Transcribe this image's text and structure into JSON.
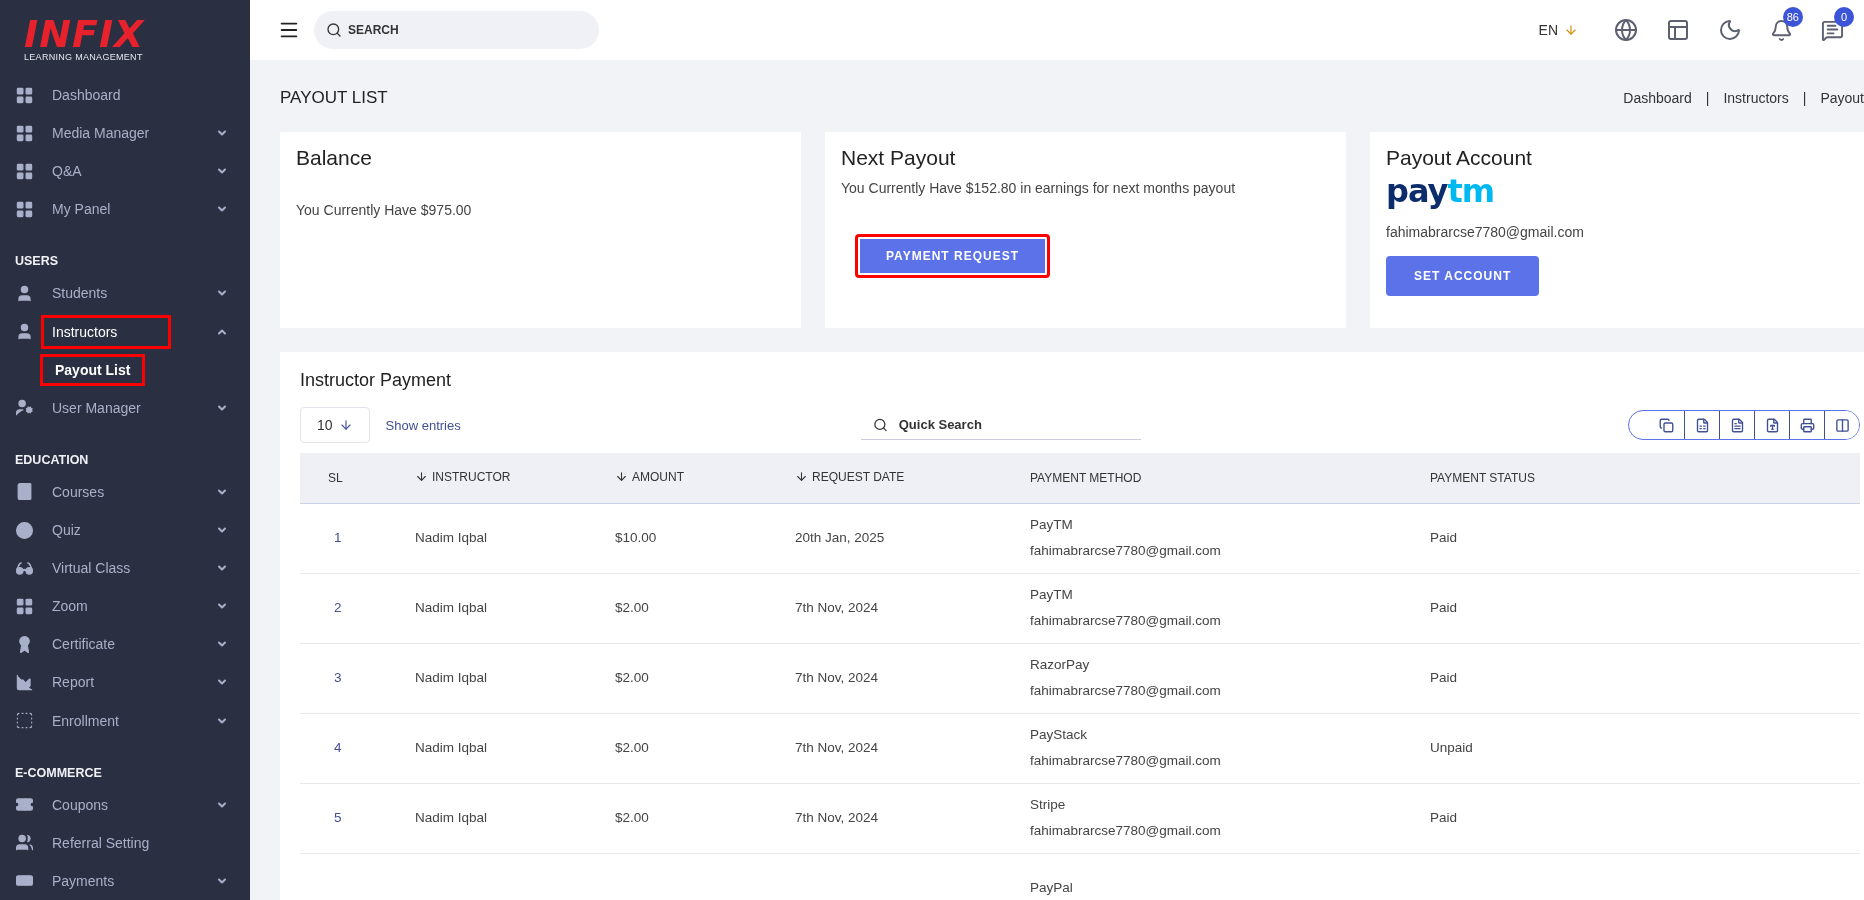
{
  "logo": {
    "brand": "INFIX",
    "tagline": "LEARNING MANAGEMENT"
  },
  "sidebar": {
    "sections": [
      {
        "items": [
          {
            "label": "Dashboard",
            "expandable": false,
            "expanded": false,
            "highlighted": false
          },
          {
            "label": "Media Manager",
            "expandable": true,
            "expanded": false,
            "highlighted": false
          },
          {
            "label": "Q&A",
            "expandable": true,
            "expanded": false,
            "highlighted": false
          },
          {
            "label": "My Panel",
            "expandable": true,
            "expanded": false,
            "highlighted": false
          }
        ]
      },
      {
        "heading": "USERS",
        "items": [
          {
            "label": "Students",
            "expandable": true,
            "expanded": false,
            "highlighted": false
          },
          {
            "label": "Instructors",
            "expandable": true,
            "expanded": true,
            "highlighted": true,
            "children": [
              {
                "label": "Payout List",
                "selected": true,
                "highlighted": true
              }
            ]
          },
          {
            "label": "User Manager",
            "expandable": true,
            "expanded": false,
            "highlighted": false
          }
        ]
      },
      {
        "heading": "EDUCATION",
        "items": [
          {
            "label": "Courses",
            "expandable": true,
            "expanded": false,
            "highlighted": false
          },
          {
            "label": "Quiz",
            "expandable": true,
            "expanded": false,
            "highlighted": false
          },
          {
            "label": "Virtual Class",
            "expandable": true,
            "expanded": false,
            "highlighted": false
          },
          {
            "label": "Zoom",
            "expandable": true,
            "expanded": false,
            "highlighted": false
          },
          {
            "label": "Certificate",
            "expandable": true,
            "expanded": false,
            "highlighted": false
          },
          {
            "label": "Report",
            "expandable": true,
            "expanded": false,
            "highlighted": false
          },
          {
            "label": "Enrollment",
            "expandable": true,
            "expanded": false,
            "highlighted": false
          }
        ]
      },
      {
        "heading": "E-COMMERCE",
        "items": [
          {
            "label": "Coupons",
            "expandable": true,
            "expanded": false,
            "highlighted": false
          },
          {
            "label": "Referral Setting",
            "expandable": false,
            "expanded": false,
            "highlighted": false
          },
          {
            "label": "Payments",
            "expandable": true,
            "expanded": false,
            "highlighted": false
          }
        ]
      }
    ]
  },
  "topbar": {
    "search": {
      "placeholder": "SEARCH"
    },
    "language": "EN",
    "notifications": "86",
    "messages": "0"
  },
  "page": {
    "title": "PAYOUT LIST",
    "breadcrumbs": [
      "Dashboard",
      "Instructors",
      "Payout"
    ],
    "separator": "|"
  },
  "cards": {
    "balance": {
      "title": "Balance",
      "text": "You Currently Have $975.00"
    },
    "next_payout": {
      "title": "Next Payout",
      "text": "You Currently Have $152.80 in earnings for next months payout",
      "button": "PAYMENT REQUEST",
      "highlighted": true
    },
    "payout_account": {
      "title": "Payout Account",
      "logo_parts": [
        "pay",
        "tm"
      ],
      "email": "fahimabrarcse7780@gmail.com",
      "button": "SET ACCOUNT"
    }
  },
  "table": {
    "title": "Instructor Payment",
    "page_size": "10",
    "show_entries": "Show entries",
    "search": {
      "placeholder": "Quick Search"
    },
    "columns": [
      {
        "label": "SL",
        "sortable": false
      },
      {
        "label": "INSTRUCTOR",
        "sortable": true
      },
      {
        "label": "AMOUNT",
        "sortable": true
      },
      {
        "label": "REQUEST DATE",
        "sortable": true
      },
      {
        "label": "PAYMENT METHOD",
        "sortable": false
      },
      {
        "label": "PAYMENT STATUS",
        "sortable": false
      }
    ],
    "rows": [
      {
        "sl": "1",
        "instructor": "Nadim Iqbal",
        "amount": "$10.00",
        "date": "20th Jan, 2025",
        "method": "PayTM",
        "email": "fahimabrarcse7780@gmail.com",
        "status": "Paid"
      },
      {
        "sl": "2",
        "instructor": "Nadim Iqbal",
        "amount": "$2.00",
        "date": "7th Nov, 2024",
        "method": "PayTM",
        "email": "fahimabrarcse7780@gmail.com",
        "status": "Paid"
      },
      {
        "sl": "3",
        "instructor": "Nadim Iqbal",
        "amount": "$2.00",
        "date": "7th Nov, 2024",
        "method": "RazorPay",
        "email": "fahimabrarcse7780@gmail.com",
        "status": "Paid"
      },
      {
        "sl": "4",
        "instructor": "Nadim Iqbal",
        "amount": "$2.00",
        "date": "7th Nov, 2024",
        "method": "PayStack",
        "email": "fahimabrarcse7780@gmail.com",
        "status": "Unpaid"
      },
      {
        "sl": "5",
        "instructor": "Nadim Iqbal",
        "amount": "$2.00",
        "date": "7th Nov, 2024",
        "method": "Stripe",
        "email": "fahimabrarcse7780@gmail.com",
        "status": "Paid"
      },
      {
        "method": "PayPal"
      }
    ]
  }
}
